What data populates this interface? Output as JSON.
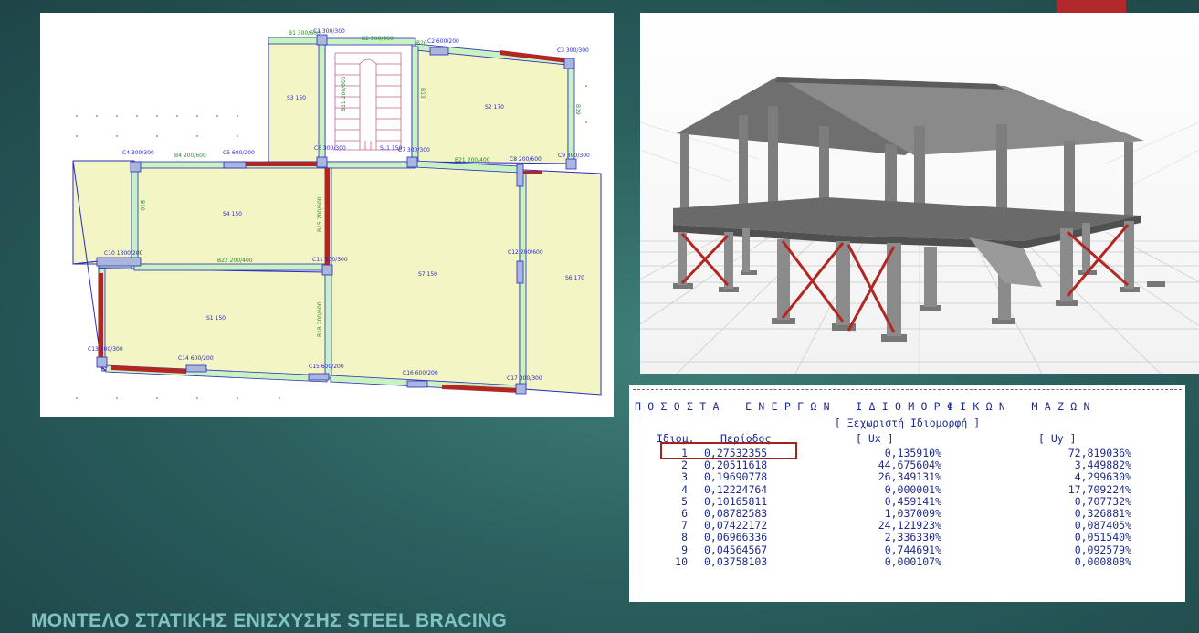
{
  "slide": {
    "title": "ΜΟΝΤΕΛΟ ΣΤΑΤΙΚΗΣ ΕΝΙΣΧΥΣΗΣ STEEL BRACING"
  },
  "colors": {
    "accent": "#b3282a",
    "slab_fill": "#f3f5c4",
    "beam_fill": "#c9f2c1",
    "column_fill": "#aab6dc",
    "bracing": "#b22722",
    "table_text": "#1d2b8a"
  },
  "plan": {
    "labels": {
      "b1": "B1 300/600",
      "c1": "C1 300/300",
      "b2": "B2 300/600",
      "b20": "B20",
      "c2": "C2 600/200",
      "c3": "C3 300/300",
      "s3": "S3 150",
      "s2": "S2 170",
      "b11": "B11 200/600",
      "b13": "B13",
      "b19": "B19",
      "c4": "C4 300/300",
      "b4": "B4 200/600",
      "c5": "C5 600/200",
      "c6": "C6 300/300",
      "sl1": "SL1 150",
      "c7": "C7 300/300",
      "b21": "B21 200/400",
      "c8": "C8 200/600",
      "c9": "C9 300/300",
      "s4": "S4 150",
      "b15": "B15 200/600",
      "b10": "B10",
      "c10": "C10 1300/200",
      "c11": "C11 300/300",
      "b22": "B22 200/400",
      "c12": "C12 200/600",
      "s7": "S7 150",
      "s6": "S6 170",
      "s1": "S1 150",
      "b18": "B18 200/600",
      "c13": "C13 300/300",
      "c14": "C14 600/200",
      "c15": "C15 600/200",
      "c16": "C16 600/200",
      "c17": "C17 300/300"
    }
  },
  "table": {
    "title": "Π Ο Σ Ο Σ Τ Α    Ε Ν Ε Ρ Γ Ω Ν    Ι Δ Ι Ο Μ Ο Ρ Φ Ι Κ Ω Ν    Μ Α Ζ Ω Ν",
    "subtitle": "[ Ξεχωριστή Ιδιομορφή ]",
    "headers": {
      "mode": "Ιδιομ.",
      "period": "Περίοδος",
      "ux": "[    Ux    ]",
      "uy": "[    Uy    ]"
    },
    "rows": [
      {
        "mode": "1",
        "period": "0,27532355",
        "ux": "0,135910%",
        "uy": "72,819036%"
      },
      {
        "mode": "2",
        "period": "0,20511618",
        "ux": "44,675604%",
        "uy": "3,449882%"
      },
      {
        "mode": "3",
        "period": "0,19690778",
        "ux": "26,349131%",
        "uy": "4,299630%"
      },
      {
        "mode": "4",
        "period": "0,12224764",
        "ux": "0,000001%",
        "uy": "17,709224%"
      },
      {
        "mode": "5",
        "period": "0,10165811",
        "ux": "0,459141%",
        "uy": "0,707732%"
      },
      {
        "mode": "6",
        "period": "0,08782583",
        "ux": "1,037009%",
        "uy": "0,326881%"
      },
      {
        "mode": "7",
        "period": "0,07422172",
        "ux": "24,121923%",
        "uy": "0,087405%"
      },
      {
        "mode": "8",
        "period": "0,06966336",
        "ux": "2,336330%",
        "uy": "0,051540%"
      },
      {
        "mode": "9",
        "period": "0,04564567",
        "ux": "0,744691%",
        "uy": "0,092579%"
      },
      {
        "mode": "10",
        "period": "0,03758103",
        "ux": "0,000107%",
        "uy": "0,000808%"
      }
    ]
  }
}
